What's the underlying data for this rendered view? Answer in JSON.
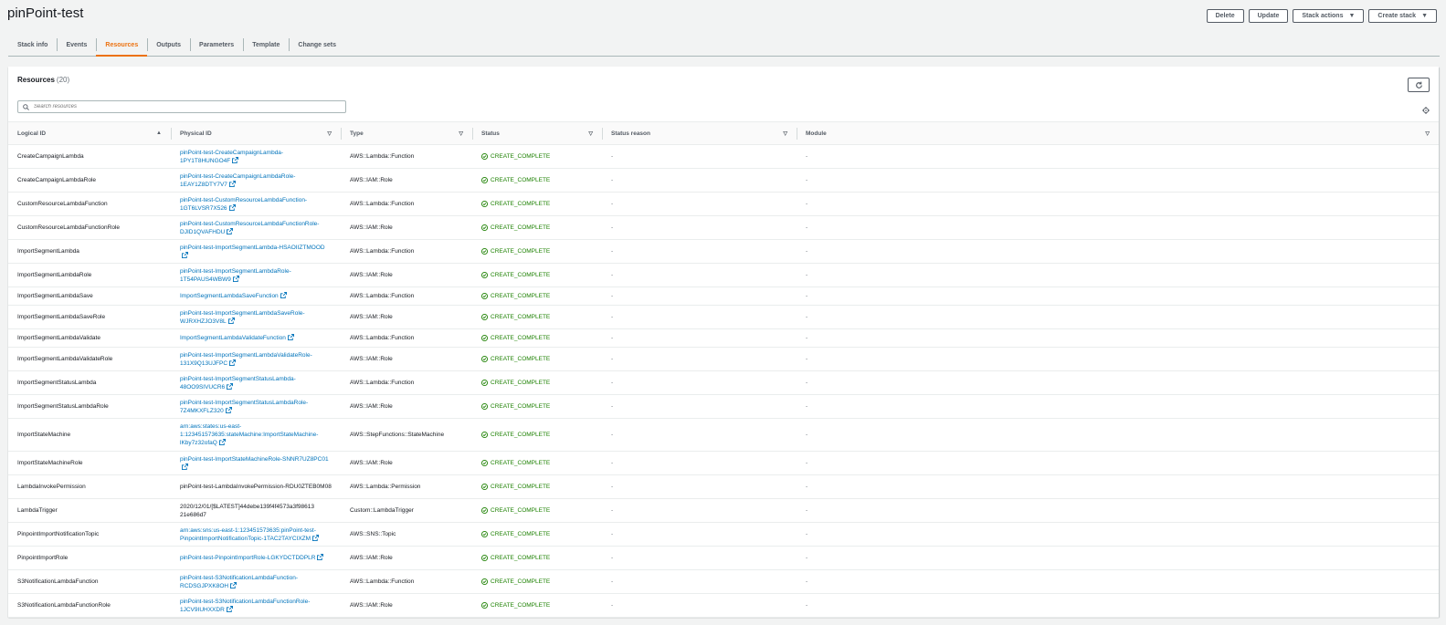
{
  "stack": {
    "title": "pinPoint-test"
  },
  "actions": {
    "delete": "Delete",
    "update": "Update",
    "stack_actions": "Stack actions",
    "create_stack": "Create stack"
  },
  "tabs": [
    {
      "label": "Stack info"
    },
    {
      "label": "Events"
    },
    {
      "label": "Resources"
    },
    {
      "label": "Outputs"
    },
    {
      "label": "Parameters"
    },
    {
      "label": "Template"
    },
    {
      "label": "Change sets"
    }
  ],
  "resources": {
    "title": "Resources",
    "count": "(20)",
    "search_placeholder": "Search resources",
    "columns": [
      "Logical ID",
      "Physical ID",
      "Type",
      "Status",
      "Status reason",
      "Module"
    ],
    "rows": [
      {
        "logical_id": "CreateCampaignLambda",
        "physical_id": "pinPoint-test-CreateCampaignLambda-1PY1T8HUNGO4F",
        "type": "AWS::Lambda::Function",
        "status": "CREATE_COMPLETE",
        "reason": "-",
        "module": "-"
      },
      {
        "logical_id": "CreateCampaignLambdaRole",
        "physical_id": "pinPoint-test-CreateCampaignLambdaRole-1EAY1Z8DTY7V7",
        "type": "AWS::IAM::Role",
        "status": "CREATE_COMPLETE",
        "reason": "-",
        "module": "-"
      },
      {
        "logical_id": "CustomResourceLambdaFunction",
        "physical_id": "pinPoint-test-CustomResourceLambdaFunction-1GT6LVSR7X526",
        "type": "AWS::Lambda::Function",
        "status": "CREATE_COMPLETE",
        "reason": "-",
        "module": "-"
      },
      {
        "logical_id": "CustomResourceLambdaFunctionRole",
        "physical_id": "pinPoint-test-CustomResourceLambdaFunctionRole-DJID1QVAFHDU",
        "type": "AWS::IAM::Role",
        "status": "CREATE_COMPLETE",
        "reason": "-",
        "module": "-"
      },
      {
        "logical_id": "ImportSegmentLambda",
        "physical_id": "pinPoint-test-ImportSegmentLambda-HSAOIIZTMOOD",
        "type": "AWS::Lambda::Function",
        "status": "CREATE_COMPLETE",
        "reason": "-",
        "module": "-"
      },
      {
        "logical_id": "ImportSegmentLambdaRole",
        "physical_id": "pinPoint-test-ImportSegmentLambdaRole-1T54PAUS4WBW9",
        "type": "AWS::IAM::Role",
        "status": "CREATE_COMPLETE",
        "reason": "-",
        "module": "-"
      },
      {
        "logical_id": "ImportSegmentLambdaSave",
        "physical_id": "ImportSegmentLambdaSaveFunction",
        "type": "AWS::Lambda::Function",
        "status": "CREATE_COMPLETE",
        "reason": "-",
        "module": "-"
      },
      {
        "logical_id": "ImportSegmentLambdaSaveRole",
        "physical_id": "pinPoint-test-ImportSegmentLambdaSaveRole-WJRXHZJO3V8L",
        "type": "AWS::IAM::Role",
        "status": "CREATE_COMPLETE",
        "reason": "-",
        "module": "-"
      },
      {
        "logical_id": "ImportSegmentLambdaValidate",
        "physical_id": "ImportSegmentLambdaValidateFunction",
        "type": "AWS::Lambda::Function",
        "status": "CREATE_COMPLETE",
        "reason": "-",
        "module": "-"
      },
      {
        "logical_id": "ImportSegmentLambdaValidateRole",
        "physical_id": "pinPoint-test-ImportSegmentLambdaValidateRole-131X9Q13UJFPC",
        "type": "AWS::IAM::Role",
        "status": "CREATE_COMPLETE",
        "reason": "-",
        "module": "-"
      },
      {
        "logical_id": "ImportSegmentStatusLambda",
        "physical_id": "pinPoint-test-ImportSegmentStatusLambda-48OO9SIVUCR6",
        "type": "AWS::Lambda::Function",
        "status": "CREATE_COMPLETE",
        "reason": "-",
        "module": "-"
      },
      {
        "logical_id": "ImportSegmentStatusLambdaRole",
        "physical_id": "pinPoint-test-ImportSegmentStatusLambdaRole-7Z4MKXFLZ320",
        "type": "AWS::IAM::Role",
        "status": "CREATE_COMPLETE",
        "reason": "-",
        "module": "-"
      },
      {
        "logical_id": "ImportStateMachine",
        "physical_id": "arn:aws:states:us-east-1:123451573635:stateMachine:ImportStateMachine-lKby7z32ofaQ",
        "type": "AWS::StepFunctions::StateMachine",
        "status": "CREATE_COMPLETE",
        "reason": "-",
        "module": "-"
      },
      {
        "logical_id": "ImportStateMachineRole",
        "physical_id": "pinPoint-test-ImportStateMachineRole-SNNR7UZ8PC01",
        "type": "AWS::IAM::Role",
        "status": "CREATE_COMPLETE",
        "reason": "-",
        "module": "-"
      },
      {
        "logical_id": "LambdaInvokePermission",
        "physical_id": "pinPoint-test-LambdaInvokePermission-RDU0ZTEB0M08",
        "type": "AWS::Lambda::Permission",
        "status": "CREATE_COMPLETE",
        "reason": "-",
        "module": "-"
      },
      {
        "logical_id": "LambdaTrigger",
        "physical_id": "2020/12/01/[$LATEST]44debe139f4f4573a3f98613 21e686d7",
        "type": "Custom::LambdaTrigger",
        "status": "CREATE_COMPLETE",
        "reason": "-",
        "module": "-"
      },
      {
        "logical_id": "PinpointImportNotificationTopic",
        "physical_id": "arn:aws:sns:us-east-1:123451573635:pinPoint-test-PinpointImportNotificationTopic-1TAC2TAYCIXZM",
        "type": "AWS::SNS::Topic",
        "status": "CREATE_COMPLETE",
        "reason": "-",
        "module": "-"
      },
      {
        "logical_id": "PinpointImportRole",
        "physical_id": "pinPoint-test-PinpointImportRole-LGKYDCTDDPLR",
        "type": "AWS::IAM::Role",
        "status": "CREATE_COMPLETE",
        "reason": "-",
        "module": "-"
      },
      {
        "logical_id": "S3NotificationLambdaFunction",
        "physical_id": "pinPoint-test-S3NotificationLambdaFunction-RCDSGJPXK8OH",
        "type": "AWS::Lambda::Function",
        "status": "CREATE_COMPLETE",
        "reason": "-",
        "module": "-"
      },
      {
        "logical_id": "S3NotificationLambdaFunctionRole",
        "physical_id": "pinPoint-test-S3NotificationLambdaFunctionRole-1JCV9IUHXXDR",
        "type": "AWS::IAM::Role",
        "status": "CREATE_COMPLETE",
        "reason": "-",
        "module": "-"
      }
    ]
  }
}
